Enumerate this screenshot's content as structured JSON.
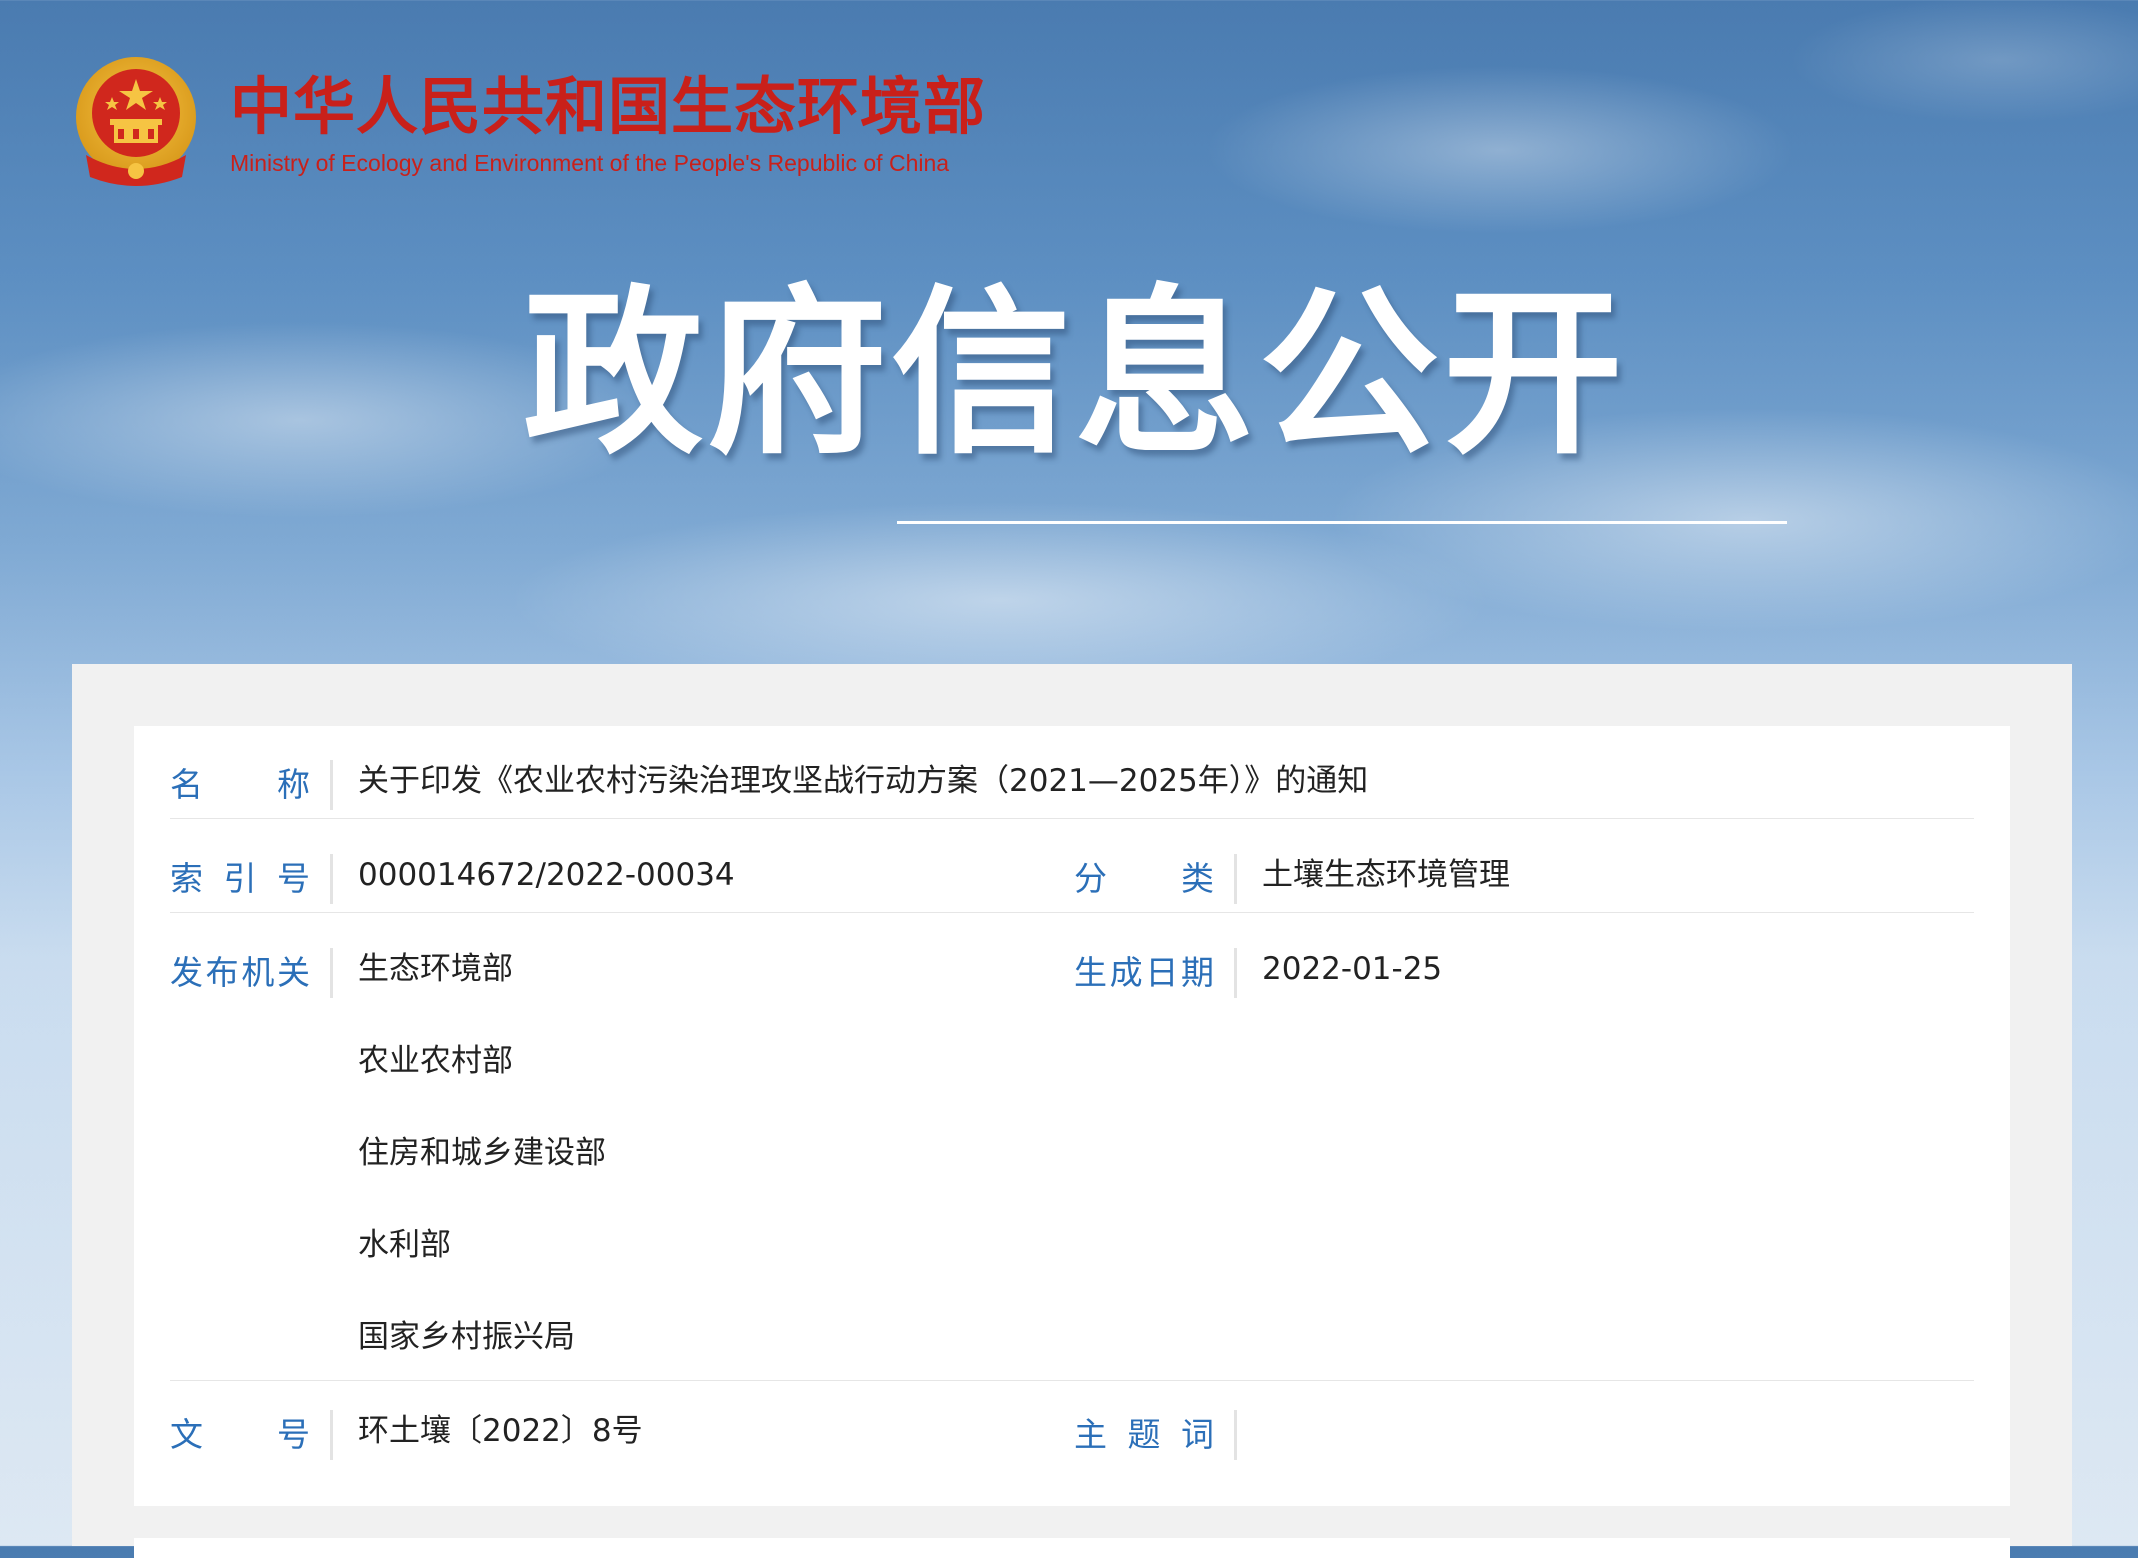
{
  "header": {
    "ministry_cn": "中华人民共和国生态环境部",
    "ministry_en": "Ministry of Ecology and Environment of the People's Republic of China",
    "banner_title": "政府信息公开"
  },
  "info": {
    "name_label_chars": [
      "名",
      "称"
    ],
    "name_value": "关于印发《农业农村污染治理攻坚战行动方案（2021—2025年）》的通知",
    "index_label_chars": [
      "索",
      "引",
      "号"
    ],
    "index_value": "000014672/2022-00034",
    "category_label_chars": [
      "分",
      "类"
    ],
    "category_value": "土壤生态环境管理",
    "issuer_label_chars": [
      "发",
      "布",
      "机",
      "关"
    ],
    "issuers": [
      "生态环境部",
      "农业农村部",
      "住房和城乡建设部",
      "水利部",
      "国家乡村振兴局"
    ],
    "date_label_chars": [
      "生",
      "成",
      "日",
      "期"
    ],
    "date_value": "2022-01-25",
    "doc_no_label_chars": [
      "文",
      "号"
    ],
    "doc_no_value": "环土壤〔2022〕8号",
    "keywords_label_chars": [
      "主",
      "题",
      "词"
    ],
    "keywords_value": ""
  },
  "colors": {
    "brand_red": "#c9201a",
    "label_blue": "#2b6fb8"
  }
}
